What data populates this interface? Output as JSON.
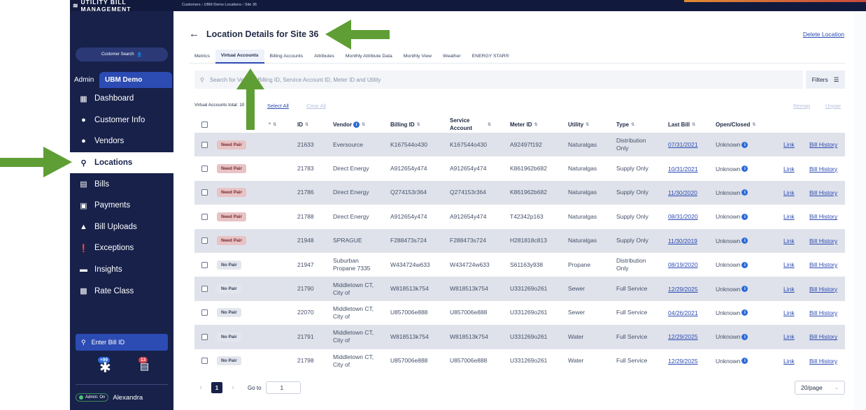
{
  "app": {
    "brand": "UTILITY BILL MANAGEMENT"
  },
  "breadcrumb": "Customers › UBM Demo Locations › Site 36",
  "sidebar": {
    "customer_search": "Customer Search",
    "scope_admin": "Admin",
    "scope_tenant": "UBM Demo",
    "items": [
      {
        "label": "Dashboard",
        "icon": "dashboard-icon"
      },
      {
        "label": "Customer Info",
        "icon": "person-icon"
      },
      {
        "label": "Vendors",
        "icon": "person-icon"
      },
      {
        "label": "Locations",
        "icon": "location-pin-icon",
        "active": true
      },
      {
        "label": "Bills",
        "icon": "bill-icon"
      },
      {
        "label": "Payments",
        "icon": "payment-icon"
      },
      {
        "label": "Bill Uploads",
        "icon": "upload-icon"
      },
      {
        "label": "Exceptions",
        "icon": "exclamation-icon"
      },
      {
        "label": "Insights",
        "icon": "insights-icon"
      },
      {
        "label": "Rate Class",
        "icon": "chart-icon"
      }
    ],
    "bill_id_search": "Enter Bill ID",
    "badge_asterisk": "+99",
    "badge_bills": "13",
    "admin_toggle": "Admin: On",
    "user_name": "Alexandra"
  },
  "page": {
    "title": "Location Details for Site 36",
    "delete_link": "Delete Location",
    "tabs": [
      {
        "label": "Metrics"
      },
      {
        "label": "Virtual Accounts",
        "active": true
      },
      {
        "label": "Billing Accounts"
      },
      {
        "label": "Attributes"
      },
      {
        "label": "Monthly Attribute Data"
      },
      {
        "label": "Monthly View"
      },
      {
        "label": "Weather"
      },
      {
        "label": "ENERGY STAR®"
      }
    ],
    "search_placeholder": "Search for Vendor, Billing ID, Service Account ID, Meter ID and Utility",
    "filters_label": "Filters",
    "totals_label": "Virtual Accounts total: 10",
    "select_all": "Select All",
    "clear_all": "Clear All",
    "remap": "Remap",
    "unpair": "Unpair"
  },
  "table": {
    "headers": {
      "asterisk": "*",
      "id": "ID",
      "vendor": "Vendor",
      "billing_id": "Billing ID",
      "service_account": "Service Account",
      "meter_id": "Meter ID",
      "utility": "Utility",
      "type": "Type",
      "last_bill": "Last Bill",
      "open_closed": "Open/Closed"
    },
    "rows": [
      {
        "pair": "Need Pair",
        "id": "21633",
        "vendor": "Eversource",
        "billing_id": "K167544o430",
        "service_account": "K167544o430",
        "meter_id": "A92497f192",
        "utility": "Naturalgas",
        "type": "Distribution Only",
        "last_bill": "07/31/2021",
        "status": "Unknown",
        "link": "Link",
        "history": "Bill History"
      },
      {
        "pair": "Need Pair",
        "id": "21783",
        "vendor": "Direct Energy",
        "billing_id": "A912654y474",
        "service_account": "A912654y474",
        "meter_id": "K861962b682",
        "utility": "Naturalgas",
        "type": "Supply Only",
        "last_bill": "10/31/2021",
        "status": "Unknown",
        "link": "Link",
        "history": "Bill History"
      },
      {
        "pair": "Need Pair",
        "id": "21786",
        "vendor": "Direct Energy",
        "billing_id": "Q274153r364",
        "service_account": "Q274153r364",
        "meter_id": "K861962b682",
        "utility": "Naturalgas",
        "type": "Supply Only",
        "last_bill": "11/30/2020",
        "status": "Unknown",
        "link": "Link",
        "history": "Bill History"
      },
      {
        "pair": "Need Pair",
        "id": "21788",
        "vendor": "Direct Energy",
        "billing_id": "A912654y474",
        "service_account": "A912654y474",
        "meter_id": "T42342p163",
        "utility": "Naturalgas",
        "type": "Supply Only",
        "last_bill": "08/31/2020",
        "status": "Unknown",
        "link": "Link",
        "history": "Bill History"
      },
      {
        "pair": "Need Pair",
        "id": "21948",
        "vendor": "SPRAGUE",
        "billing_id": "F288473s724",
        "service_account": "F288473s724",
        "meter_id": "H281818c813",
        "utility": "Naturalgas",
        "type": "Supply Only",
        "last_bill": "11/30/2019",
        "status": "Unknown",
        "link": "Link",
        "history": "Bill History"
      },
      {
        "pair": "No Pair",
        "id": "21947",
        "vendor": "Suburban Propane 7335",
        "billing_id": "W434724w633",
        "service_account": "W434724w633",
        "meter_id": "S61163y938",
        "utility": "Propane",
        "type": "Distribution Only",
        "last_bill": "08/19/2020",
        "status": "Unknown",
        "link": "Link",
        "history": "Bill History"
      },
      {
        "pair": "No Pair",
        "id": "21790",
        "vendor": "Middletown CT, City of",
        "billing_id": "W818513k754",
        "service_account": "W818513k754",
        "meter_id": "U331269o261",
        "utility": "Sewer",
        "type": "Full Service",
        "last_bill": "12/29/2025",
        "status": "Unknown",
        "link": "Link",
        "history": "Bill History"
      },
      {
        "pair": "No Pair",
        "id": "22070",
        "vendor": "Middletown CT, City of",
        "billing_id": "U857006e888",
        "service_account": "U857006e888",
        "meter_id": "U331269o261",
        "utility": "Sewer",
        "type": "Full Service",
        "last_bill": "04/26/2021",
        "status": "Unknown",
        "link": "Link",
        "history": "Bill History"
      },
      {
        "pair": "No Pair",
        "id": "21791",
        "vendor": "Middletown CT, City of",
        "billing_id": "W818513k754",
        "service_account": "W818513k754",
        "meter_id": "U331269o261",
        "utility": "Water",
        "type": "Full Service",
        "last_bill": "12/29/2025",
        "status": "Unknown",
        "link": "Link",
        "history": "Bill History"
      },
      {
        "pair": "No Pair",
        "id": "21798",
        "vendor": "Middletown CT, City of",
        "billing_id": "U857006e888",
        "service_account": "U857006e888",
        "meter_id": "U331269o261",
        "utility": "Water",
        "type": "Full Service",
        "last_bill": "12/29/2025",
        "status": "Unknown",
        "link": "Link",
        "history": "Bill History"
      }
    ]
  },
  "pagination": {
    "current_page": "1",
    "goto_label": "Go to",
    "goto_value": "1",
    "per_page": "20/page"
  },
  "colors": {
    "sidebar_bg": "#17214a",
    "accent_blue": "#2c4bb3",
    "annotation_arrow": "#5f9e34",
    "need_pair_bg": "#e8c3c5"
  }
}
